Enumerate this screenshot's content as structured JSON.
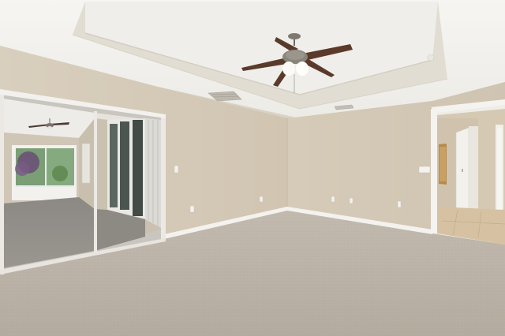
{
  "scene": {
    "type": "photo",
    "colors": {
      "ceiling": "#f0efec",
      "tray_border": "#e3ded3",
      "wall_left": "#d6cbb9",
      "wall_right": "#d3c8b6",
      "carpet": "#b8afa4",
      "baseboard": "#f4f2ee",
      "fan_blade": "#5b3a2c",
      "mirror_floor": "#8e8a84",
      "window_glass": "#7aa27a",
      "doorway_floor": "#d8c6a8"
    }
  }
}
